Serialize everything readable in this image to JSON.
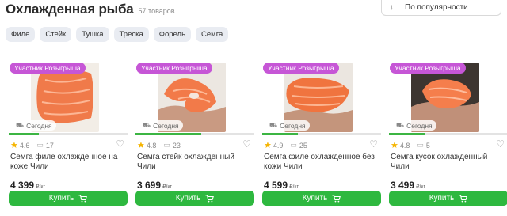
{
  "header": {
    "title": "Охлажденная рыба",
    "count": "57 товаров"
  },
  "sort": {
    "arrow": "↓",
    "label": "По популярности"
  },
  "chips": [
    "Филе",
    "Стейк",
    "Тушка",
    "Треска",
    "Форель",
    "Семга"
  ],
  "colors": {
    "accent": "#2eb83f",
    "badge": "#c656d6",
    "star": "#f5b400"
  },
  "products": [
    {
      "badge": "Участник Розыгрыша",
      "delivery": "Сегодня",
      "stock_fraction": 0.25,
      "rating": "4.6",
      "reviews": "17",
      "name": "Семга филе охлажденное на коже Чили",
      "price": "4 399",
      "unit": "₽/кг",
      "buy_label": "Купить"
    },
    {
      "badge": "Участник Розыгрыша",
      "delivery": "Сегодня",
      "stock_fraction": 0.55,
      "rating": "4.8",
      "reviews": "23",
      "name": "Семга стейк охлажденный Чили",
      "price": "3 699",
      "unit": "₽/кг",
      "buy_label": "Купить"
    },
    {
      "badge": "Участник Розыгрыша",
      "delivery": "Сегодня",
      "stock_fraction": 0.3,
      "rating": "4.9",
      "reviews": "25",
      "name": "Семга филе охлажденное без кожи Чили",
      "price": "4 599",
      "unit": "₽/кг",
      "buy_label": "Купить"
    },
    {
      "badge": "Участник Розыгрыша",
      "delivery": "Сегодня",
      "stock_fraction": 0.3,
      "rating": "4.8",
      "reviews": "5",
      "name": "Семга кусок охлажденный Чили",
      "price": "3 499",
      "unit": "₽/кг",
      "buy_label": "Купить"
    }
  ]
}
